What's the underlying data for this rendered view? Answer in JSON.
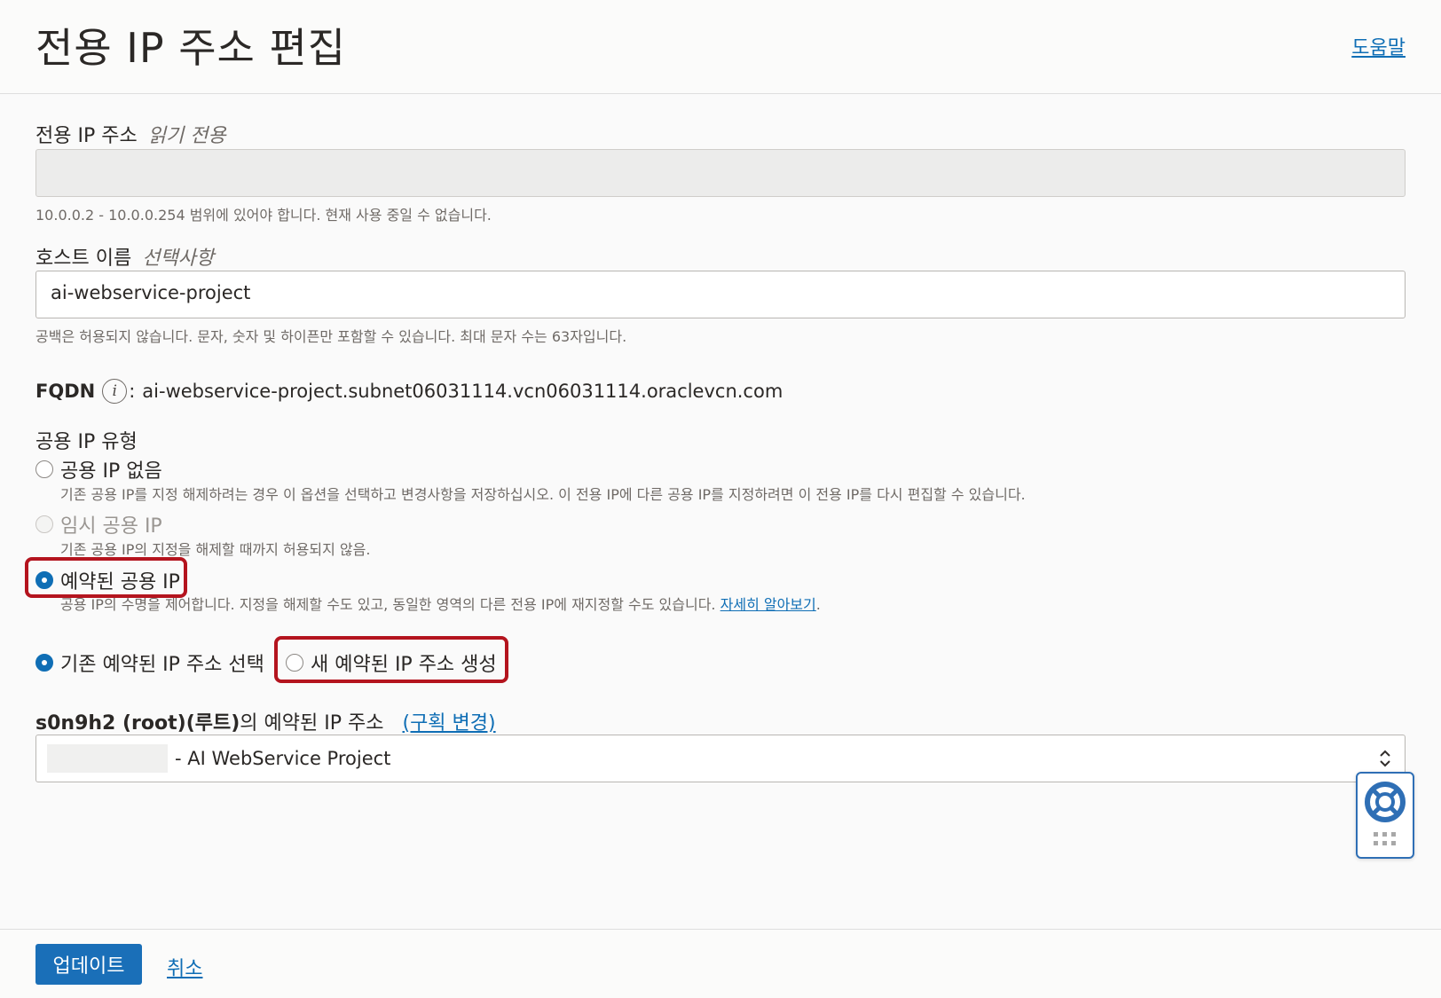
{
  "header": {
    "title": "전용 IP 주소 편집",
    "help_link": "도움말"
  },
  "private_ip": {
    "label": "전용 IP 주소",
    "hint": "읽기 전용",
    "value": "",
    "help": "10.0.0.2 - 10.0.0.254 범위에 있어야 합니다. 현재 사용 중일 수 없습니다."
  },
  "hostname": {
    "label": "호스트 이름",
    "hint": "선택사항",
    "value": "ai-webservice-project",
    "help": "공백은 허용되지 않습니다. 문자, 숫자 및 하이픈만 포함할 수 있습니다. 최대 문자 수는 63자입니다."
  },
  "fqdn": {
    "label": "FQDN",
    "info_glyph": "i",
    "separator": ":",
    "value": "ai-webservice-project.subnet06031114.vcn06031114.oraclevcn.com"
  },
  "public_ip_type": {
    "label": "공용 IP 유형",
    "options": [
      {
        "label": "공용 IP 없음",
        "checked": false,
        "disabled": false,
        "desc": "기존 공용 IP를 지정 해제하려는 경우 이 옵션을 선택하고 변경사항을 저장하십시오. 이 전용 IP에 다른 공용 IP를 지정하려면 이 전용 IP를 다시 편집할 수 있습니다."
      },
      {
        "label": "임시 공용 IP",
        "checked": false,
        "disabled": true,
        "desc": "기존 공용 IP의 지정을 해제할 때까지 허용되지 않음."
      },
      {
        "label": "예약된 공용 IP",
        "checked": true,
        "disabled": false,
        "desc": "공용 IP의 수명을 제어합니다. 지정을 해제할 수도 있고, 동일한 영역의 다른 전용 IP에 재지정할 수도 있습니다.",
        "link": "자세히 알아보기",
        "after_link": "."
      }
    ]
  },
  "reserved_choice": {
    "existing_label": "기존 예약된 IP 주소 선택",
    "new_label": "새 예약된 IP 주소 생성"
  },
  "reserved_select": {
    "label_bold": "s0n9h2 (root)(루트)",
    "label_rest": "의 예약된 IP 주소",
    "change_compartment": "(구획 변경)",
    "selected_value": "- AI WebService Project"
  },
  "footer": {
    "update_button": "업데이트",
    "cancel_link": "취소"
  },
  "colors": {
    "accent": "#0f6eb5",
    "highlight": "#b4141e",
    "primary_button": "#1a6fb8"
  }
}
